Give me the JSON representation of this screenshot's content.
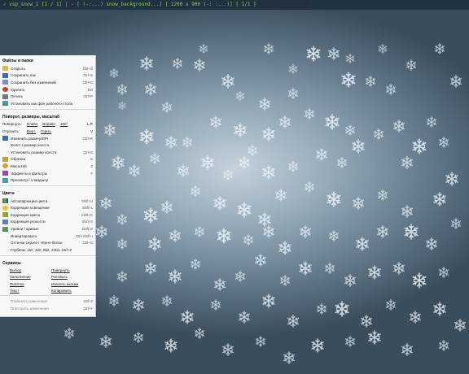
{
  "status_bar": "✓ vsp_snow_1 [1 / 1] | - [ (-:...)  snow_background...] [ 1200 x 900 (-: :...)] [ 1/1 ]",
  "menu": {
    "file_section": {
      "title": "Файлы и папки",
      "items": [
        {
          "label": "Открыть",
          "key": "Ctrl+O",
          "icon": "open-folder-icon"
        },
        {
          "label": "Сохранить как",
          "key": "Ctrl+S",
          "icon": "save-icon"
        },
        {
          "label": "Сохранить без изменений",
          "key": "Ctrl+D",
          "icon": "save-copy-icon"
        },
        {
          "label": "Удалить",
          "key": "Del",
          "icon": "delete-icon"
        },
        {
          "label": "Печать",
          "key": "Ctrl+P",
          "icon": "print-icon"
        },
        {
          "label": "Установить как фон рабочего стола",
          "key": "",
          "icon": "wallpaper-icon"
        }
      ]
    },
    "view_section": {
      "title": "Поворот, размеры, масштаб",
      "rotate_label": "Повернуть:",
      "rotate_options": [
        "Влево",
        "Вправо"
      ],
      "rotate_extra": "180°",
      "rotate_key": "L,R",
      "flip_label": "Отразить:",
      "flip_options": [
        "Верт.",
        "Гориз."
      ],
      "flip_key": "V",
      "items": [
        {
          "label": "Изменить размер/DPI",
          "key": "Ctrl+R",
          "icon": "resize-icon"
        },
        {
          "label": "Холст / размер холста",
          "key": "",
          "icon": ""
        },
        {
          "label": "Установить размер холста",
          "key": "Ctrl+E",
          "icon": ""
        },
        {
          "label": "Обрезка",
          "key": "C",
          "icon": "crop-icon"
        },
        {
          "label": "Масштаб",
          "key": "Z",
          "icon": "zoom-icon"
        },
        {
          "label": "Эффекты и фильтры",
          "key": "F",
          "icon": "effects-icon"
        },
        {
          "label": "Просмотр / слайдшоу",
          "key": "",
          "icon": "slideshow-icon"
        }
      ]
    },
    "color_section": {
      "title": "Цвета",
      "items": [
        {
          "label": "Автокоррекция цвета",
          "key": "Shift+U",
          "icon": "auto-color-icon"
        },
        {
          "label": "Коррекция освещения",
          "key": "Shift+L",
          "icon": "lighting-icon"
        },
        {
          "label": "Коррекция цвета",
          "key": "Shift+G",
          "icon": "color-icon"
        },
        {
          "label": "Коррекция резкости",
          "key": "Shift+S",
          "icon": "sharpen-icon"
        },
        {
          "label": "Уровни / кривые",
          "key": "Shift+Z",
          "icon": "levels-icon"
        },
        {
          "label": "Инвертировать",
          "key": "Ctrl+Shift+I",
          "icon": ""
        },
        {
          "label": "Оттенки серого / чёрно-белое",
          "key": "Ctrl+G",
          "icon": ""
        },
        {
          "label": "Глубина: 1bit, 4bit, 8bit, 24bit, Ctrl+Z",
          "key": "",
          "icon": ""
        }
      ]
    },
    "tools_section": {
      "title": "Сервисы",
      "links": [
        "Выбор",
        "Повернуть",
        "Заполнение",
        "Рисовать",
        "Пипетка",
        "Извлечь иконки",
        "Текст",
        "Копировать"
      ],
      "items": [
        {
          "label": "Отменить изменения",
          "key": "Ctrl+Z"
        },
        {
          "label": "Повторить изменения",
          "key": "Ctrl+Y"
        }
      ]
    }
  }
}
